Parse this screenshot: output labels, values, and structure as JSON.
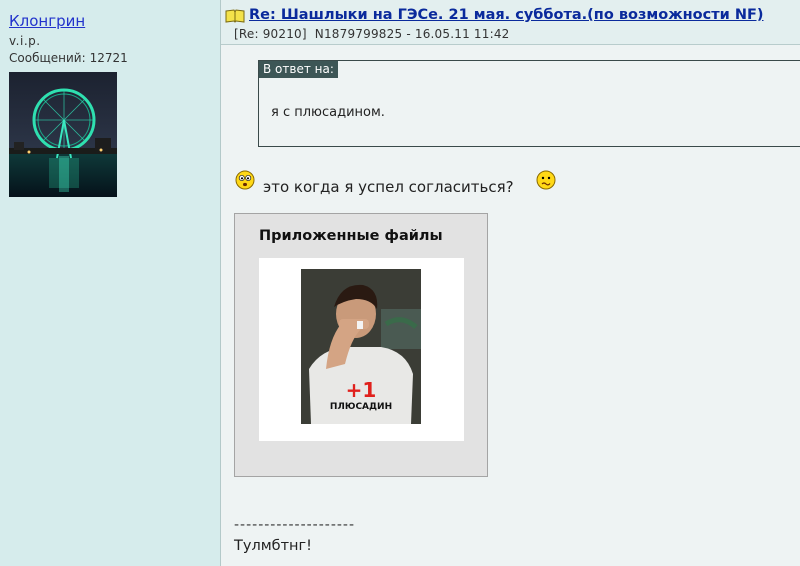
{
  "author": {
    "name": "Клонгрин",
    "rank": "v.i.p.",
    "posts_label": "Сообщений:",
    "posts_count": "12721"
  },
  "post": {
    "title": "Re: Шашлыки на ГЭСе. 21 мая. суббота.(по возможности NF)",
    "reply_ref": "[Re: 90210]",
    "meta": "N1879799825 - 16.05.11 11:42"
  },
  "quote": {
    "label": "В ответ на:",
    "text": "я с плюсадином."
  },
  "body": {
    "text": "это когда я успел согласиться?"
  },
  "attachments": {
    "title": "Приложенные файлы",
    "photo_shirt_text": "ПЛЮСАДИН",
    "photo_shirt_logo": "+1"
  },
  "signature": {
    "divider": "--------------------",
    "text": "Тулмбтнг!"
  },
  "icons": {
    "book": "book-icon",
    "smiley_left": "surprised-smiley-icon",
    "smiley_right": "confused-smiley-icon"
  },
  "colors": {
    "link": "#0a2a9c",
    "sidebar_bg": "#d6ecec",
    "quote_label_bg": "#3d5656"
  }
}
